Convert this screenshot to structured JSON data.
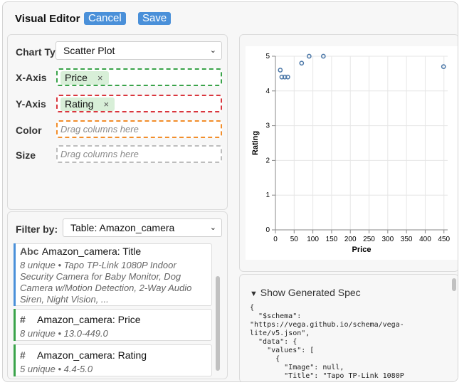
{
  "header": {
    "title": "Visual Editor",
    "cancel_label": "Cancel",
    "save_label": "Save"
  },
  "encoding": {
    "chart_type_label": "Chart Type",
    "chart_type_value": "Scatter Plot",
    "x_label": "X-Axis",
    "x_value": "Price",
    "y_label": "Y-Axis",
    "y_value": "Rating",
    "color_label": "Color",
    "color_placeholder": "Drag columns here",
    "size_label": "Size",
    "size_placeholder": "Drag columns here",
    "remove_glyph": "×"
  },
  "filter": {
    "label": "Filter by:",
    "table_value": "Table: Amazon_camera",
    "columns": [
      {
        "type": "Abc",
        "name": "Amazon_camera: Title",
        "desc": "8 unique • Tapo TP-Link 1080P Indoor Security Camera for Baby Monitor, Dog Camera w/Motion Detection, 2-Way Audio Siren, Night Vision, ..."
      },
      {
        "type": "#",
        "name": "Amazon_camera: Price",
        "desc": "8 unique • 13.0-449.0"
      },
      {
        "type": "#",
        "name": "Amazon_camera: Rating",
        "desc": "5 unique • 4.4-5.0"
      }
    ]
  },
  "spec": {
    "toggle_label": "Show Generated Spec",
    "code": "{\n  \"$schema\":\n\"https://vega.github.io/schema/vega-\nlite/v5.json\",\n  \"data\": {\n    \"values\": [\n      {\n        \"Image\": null,\n        \"Title\": \"Tapo TP-Link 1080P"
  },
  "colors": {
    "accent": "#4a90d9",
    "x_border": "#3aa34a",
    "y_border": "#d9363e",
    "color_border": "#f28e2b",
    "size_border": "#bdbdbd",
    "point": "#4c78a8"
  },
  "chart_data": {
    "type": "scatter",
    "xlabel": "Price",
    "ylabel": "Rating",
    "xlim": [
      0,
      460
    ],
    "ylim": [
      0,
      5
    ],
    "xticks": [
      0,
      50,
      100,
      150,
      200,
      250,
      300,
      350,
      400,
      450
    ],
    "yticks": [
      0,
      1,
      2,
      3,
      4,
      5
    ],
    "grid": true,
    "points": [
      {
        "x": 13,
        "y": 4.6
      },
      {
        "x": 17,
        "y": 4.4
      },
      {
        "x": 25,
        "y": 4.4
      },
      {
        "x": 33,
        "y": 4.4
      },
      {
        "x": 70,
        "y": 4.8
      },
      {
        "x": 90,
        "y": 5.0
      },
      {
        "x": 128,
        "y": 5.0
      },
      {
        "x": 449,
        "y": 4.7
      }
    ]
  }
}
